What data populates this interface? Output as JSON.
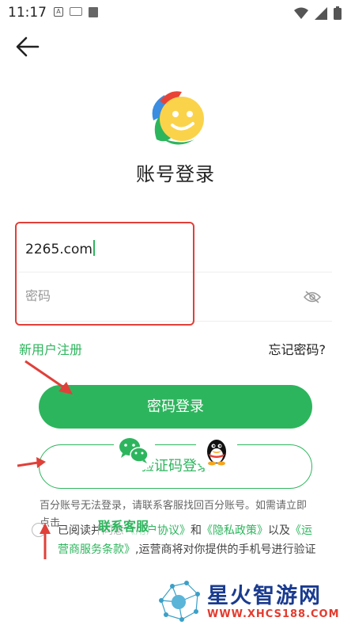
{
  "status_bar": {
    "time": "11:17",
    "input_indicator": "A"
  },
  "header": {
    "title": "账号登录"
  },
  "form": {
    "account_value": "2265.com",
    "password_placeholder": "密码"
  },
  "links": {
    "register": "新用户注册",
    "forgot": "忘记密码?"
  },
  "buttons": {
    "password_login": "密码登录",
    "sms_login": "验证码登录"
  },
  "social": [
    {
      "icon": "wechat-icon"
    },
    {
      "icon": "qq-icon"
    }
  ],
  "notice": {
    "text": "百分账号无法登录，请联系客服找回百分账号。如需请立即点击",
    "contact_link": "联系客服"
  },
  "agreement": {
    "prefix": "已阅读并同意",
    "user_agreement": "《用户协议》",
    "and": "和",
    "privacy_policy": "《隐私政策》",
    "and2": "以及",
    "carrier_terms": "《运营商服务条款》",
    "suffix": ",运营商将对你提供的手机号进行验证"
  },
  "watermark": {
    "title": "星火智游网",
    "url": "WWW.XHCS188.COM"
  },
  "colors": {
    "accent": "#2db55d",
    "highlight_box": "#e0403a",
    "watermark_blue": "#1a3b8f",
    "watermark_red": "#e33b2e"
  }
}
